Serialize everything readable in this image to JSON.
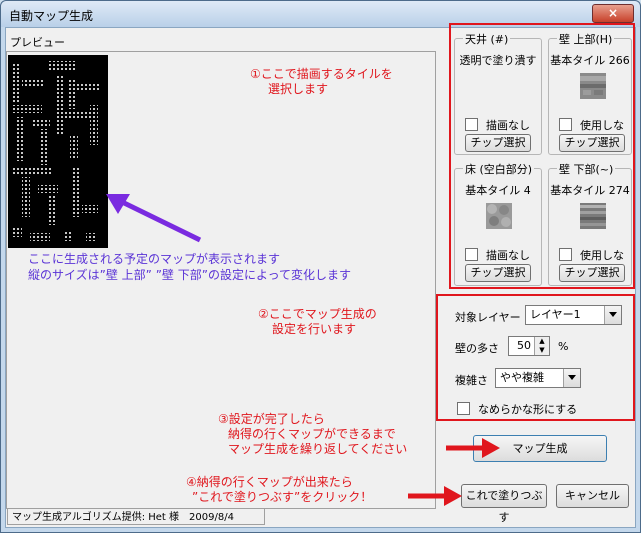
{
  "window": {
    "title": "自動マップ生成",
    "close_label": "×"
  },
  "preview": {
    "label": "プレビュー"
  },
  "tiles": {
    "ceiling": {
      "title": "天井 (#)",
      "subtitle": "透明で塗り潰す",
      "checkbox_label": "描画なし",
      "button_label": "チップ選択"
    },
    "wall_upper": {
      "title": "壁 上部(H)",
      "subtitle": "基本タイル 266",
      "checkbox_label": "使用しない",
      "button_label": "チップ選択"
    },
    "floor": {
      "title": "床 (空白部分)",
      "subtitle": "基本タイル 4",
      "checkbox_label": "描画なし",
      "button_label": "チップ選択"
    },
    "wall_lower": {
      "title": "壁 下部(~)",
      "subtitle": "基本タイル 274",
      "checkbox_label": "使用しない",
      "button_label": "チップ選択"
    }
  },
  "settings": {
    "layer_label": "対象レイヤー",
    "layer_value": "レイヤー1",
    "wall_amount_label": "壁の多さ",
    "wall_amount_value": "50",
    "wall_amount_unit": "%",
    "complexity_label": "複雑さ",
    "complexity_value": "やや複雑",
    "smooth_label": "なめらかな形にする"
  },
  "buttons": {
    "generate": "マップ生成",
    "fill": "これで塗りつぶす",
    "cancel": "キャンセル"
  },
  "status": "マップ生成アルゴリズム提供: Het 様　2009/8/4",
  "annotations": {
    "step1": [
      "①ここで描画するタイルを",
      "選択します"
    ],
    "preview_note": [
      "ここに生成される予定のマップが表示されます",
      "縦のサイズは”壁 上部” ”壁 下部”の設定によって変化します"
    ],
    "step2": [
      "②ここでマップ生成の",
      "設定を行います"
    ],
    "step3": [
      "③設定が完了したら",
      "納得の行くマップができるまで",
      "マップ生成を繰り返してください"
    ],
    "step4": [
      "④納得の行くマップが出来たら",
      "”これで塗りつぶす”をクリック！"
    ]
  },
  "colors": {
    "annotation_red": "#e0161d",
    "annotation_purple": "#5a33d6",
    "window_frame": "#c4d8ec"
  }
}
